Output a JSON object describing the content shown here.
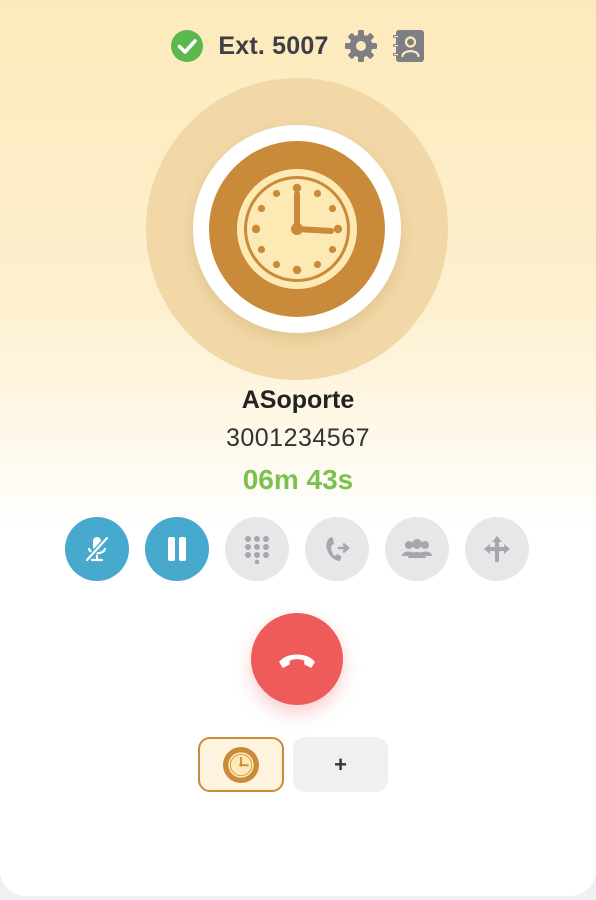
{
  "header": {
    "extension": "Ext. 5007",
    "status_icon": "check-circle-icon",
    "status_color": "#5bb84d",
    "settings_icon": "gear-icon",
    "contacts_icon": "address-book-icon"
  },
  "caller": {
    "avatar_icon": "clock-icon",
    "name": "ASoporte",
    "number": "3001234567",
    "duration": "06m 43s"
  },
  "controls": [
    {
      "name": "mute",
      "icon": "microphone-slash-icon",
      "active": true
    },
    {
      "name": "hold",
      "icon": "pause-icon",
      "active": true
    },
    {
      "name": "keypad",
      "icon": "dialpad-icon",
      "active": false
    },
    {
      "name": "transfer",
      "icon": "phone-forward-icon",
      "active": false
    },
    {
      "name": "conference",
      "icon": "group-icon",
      "active": false
    },
    {
      "name": "park",
      "icon": "arrows-icon",
      "active": false
    }
  ],
  "hangup": {
    "icon": "phone-hangup-icon",
    "color": "#ef5a5a"
  },
  "call_tabs": {
    "current_icon": "clock-icon",
    "add_label": "+"
  },
  "colors": {
    "accent_blue": "#46a9cd",
    "timer_green": "#7bc14f",
    "avatar_brown": "#c98a3a",
    "avatar_cream": "#fde9b4"
  }
}
